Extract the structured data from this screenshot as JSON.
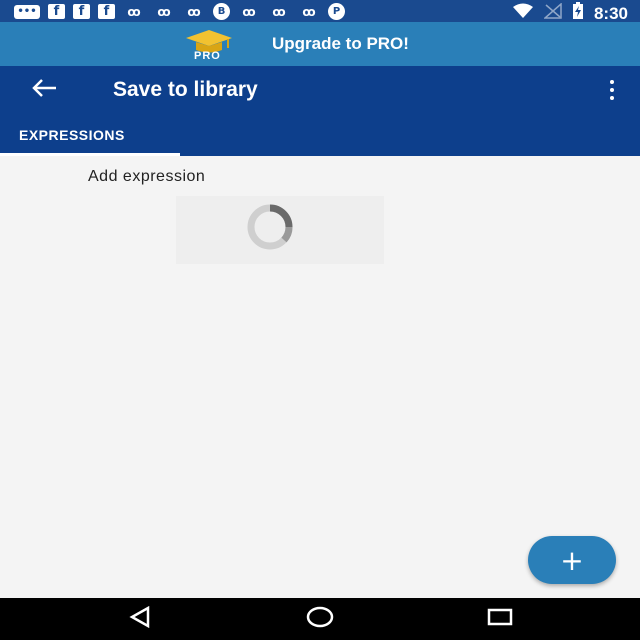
{
  "status_bar": {
    "time": "8:30",
    "notification_icons": [
      {
        "name": "messages-icon",
        "glyph": "•••",
        "style": "msg"
      },
      {
        "name": "facebook-icon-1",
        "glyph": "f",
        "style": "box"
      },
      {
        "name": "facebook-icon-2",
        "glyph": "f",
        "style": "box"
      },
      {
        "name": "facebook-icon-3",
        "glyph": "f",
        "style": "box"
      },
      {
        "name": "app-icon-1",
        "glyph": "ꝏ",
        "style": "plain"
      },
      {
        "name": "app-icon-2",
        "glyph": "ꝏ",
        "style": "plain"
      },
      {
        "name": "app-icon-3",
        "glyph": "ꝏ",
        "style": "plain"
      },
      {
        "name": "b-icon",
        "glyph": "B",
        "style": "circ"
      },
      {
        "name": "app-icon-4",
        "glyph": "ꝏ",
        "style": "plain"
      },
      {
        "name": "app-icon-5",
        "glyph": "ꝏ",
        "style": "plain"
      },
      {
        "name": "app-icon-6",
        "glyph": "ꝏ",
        "style": "plain"
      },
      {
        "name": "pinterest-icon",
        "glyph": "P",
        "style": "circ"
      }
    ]
  },
  "upgrade_banner": {
    "badge_text": "PRO",
    "label": "Upgrade to PRO!"
  },
  "app_bar": {
    "title": "Save to library",
    "back_icon": "arrow-left-icon",
    "menu_icon": "more-vert-icon"
  },
  "tabs": [
    {
      "label": "EXPRESSIONS",
      "selected": true
    }
  ],
  "content": {
    "add_expression_label": "Add expression",
    "loading": true
  },
  "fab": {
    "glyph": "+"
  },
  "colors": {
    "status_bar": "#1a4a8f",
    "banner": "#2a7fb8",
    "app_bar": "#0d3f8c",
    "background": "#f4f4f4",
    "fab": "#2a7fb8"
  }
}
